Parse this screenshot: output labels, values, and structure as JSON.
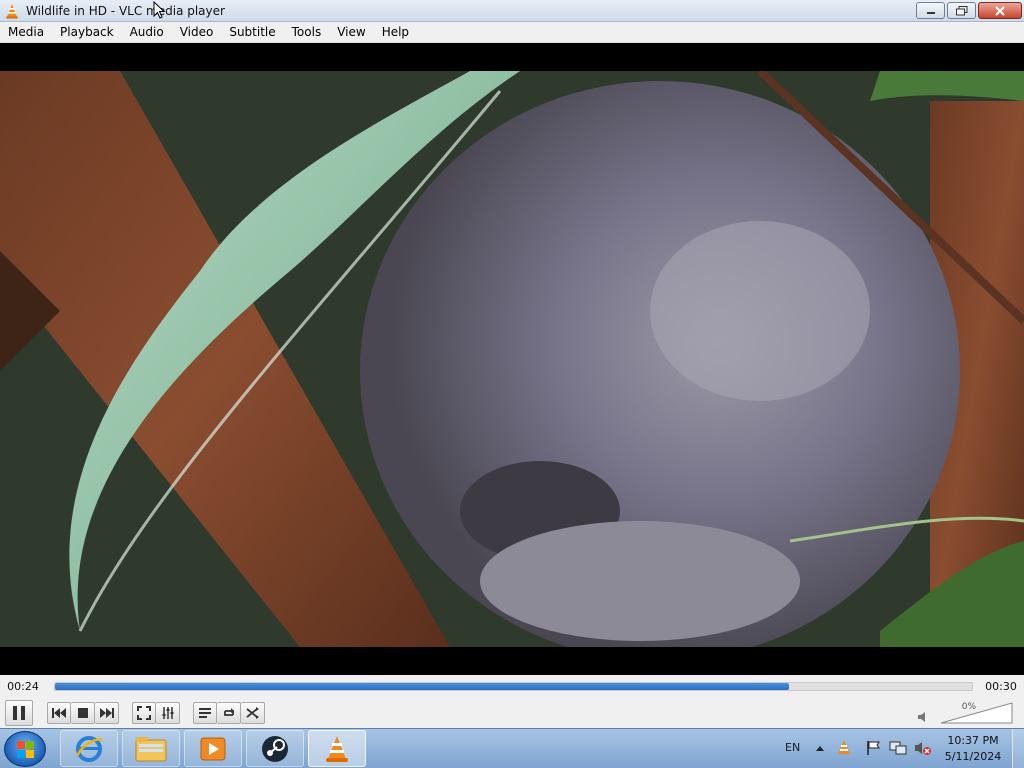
{
  "window": {
    "title": "Wildlife in HD - VLC media player",
    "app_icon": "vlc-cone-icon",
    "buttons": [
      "minimize-icon",
      "maximize-icon",
      "close-icon"
    ]
  },
  "menubar": {
    "items": [
      "Media",
      "Playback",
      "Audio",
      "Video",
      "Subtitle",
      "Tools",
      "View",
      "Help"
    ]
  },
  "player": {
    "elapsed": "00:24",
    "duration": "00:30",
    "progress_fraction": 0.8,
    "volume_label": "0%",
    "volume_fraction": 0.0,
    "accent_color": "#2d6fc2"
  },
  "controls": {
    "icons": [
      "pause-icon",
      "previous-icon",
      "stop-icon",
      "next-icon",
      "fullscreen-icon",
      "extended-settings-icon",
      "playlist-icon",
      "loop-icon",
      "shuffle-icon",
      "speaker-icon"
    ]
  },
  "taskbar": {
    "apps": [
      "internet-explorer-icon",
      "file-explorer-icon",
      "media-player-icon",
      "steam-icon",
      "vlc-cone-icon"
    ],
    "language": "EN",
    "time": "10:37 PM",
    "date": "5/11/2024"
  }
}
